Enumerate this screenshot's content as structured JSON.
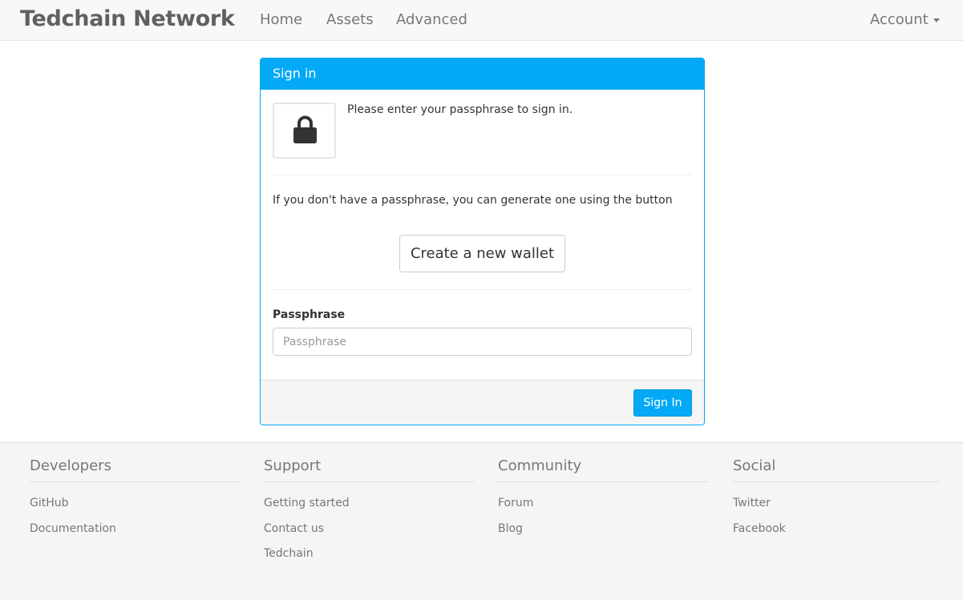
{
  "navbar": {
    "brand": "Tedchain Network",
    "links": [
      {
        "label": "Home"
      },
      {
        "label": "Assets"
      },
      {
        "label": "Advanced"
      }
    ],
    "account": "Account"
  },
  "signin_panel": {
    "title": "Sign in",
    "intro": "Please enter your passphrase to sign in.",
    "hint": "If you don't have a passphrase, you can generate one using the button",
    "create_wallet_label": "Create a new wallet",
    "passphrase_label": "Passphrase",
    "passphrase_placeholder": "Passphrase",
    "passphrase_value": "",
    "signin_label": "Sign In",
    "lock_icon": "lock-icon"
  },
  "footer": {
    "columns": [
      {
        "heading": "Developers",
        "links": [
          "GitHub",
          "Documentation"
        ]
      },
      {
        "heading": "Support",
        "links": [
          "Getting started",
          "Contact us",
          "Tedchain"
        ]
      },
      {
        "heading": "Community",
        "links": [
          "Forum",
          "Blog"
        ]
      },
      {
        "heading": "Social",
        "links": [
          "Twitter",
          "Facebook"
        ]
      }
    ]
  },
  "colors": {
    "accent": "#03a9f4",
    "navbar_bg": "#f8f8f8",
    "footer_bg": "#f5f5f5"
  }
}
